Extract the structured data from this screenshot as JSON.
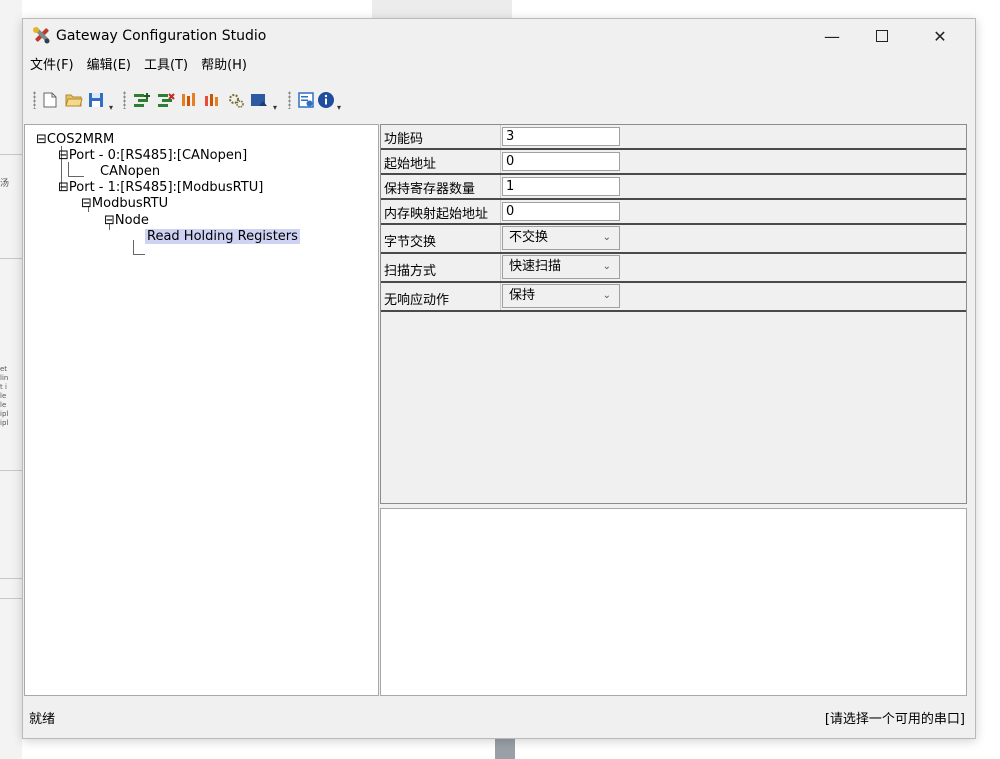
{
  "window": {
    "title": "Gateway Configuration Studio",
    "minimize_glyph": "—",
    "close_glyph": "✕"
  },
  "menu": [
    "文件(F)",
    "编辑(E)",
    "工具(T)",
    "帮助(H)"
  ],
  "toolbar": {
    "icons": [
      "new-file-icon",
      "open-folder-icon",
      "save-icon",
      "add-port-icon",
      "delete-port-icon",
      "add-node-icon",
      "add-command-icon",
      "settings-icon",
      "download-icon",
      "check-icon",
      "info-icon"
    ],
    "more_glyph": "▾"
  },
  "tree": {
    "root": "COS2MRM",
    "port0": "Port - 0:[RS485]:[CANopen]",
    "canopen": "CANopen",
    "port1": "Port - 1:[RS485]:[ModbusRTU]",
    "modbusrtu": "ModbusRTU",
    "node": "Node",
    "command": "Read Holding Registers"
  },
  "properties": [
    {
      "label": "功能码",
      "value": "3",
      "type": "text"
    },
    {
      "label": "起始地址",
      "value": "0",
      "type": "text"
    },
    {
      "label": "保持寄存器数量",
      "value": "1",
      "type": "text"
    },
    {
      "label": "内存映射起始地址",
      "value": "0",
      "type": "text"
    },
    {
      "label": "字节交换",
      "value": "不交换",
      "type": "select"
    },
    {
      "label": "扫描方式",
      "value": "快速扫描",
      "type": "select"
    },
    {
      "label": "无响应动作",
      "value": "保持",
      "type": "select"
    }
  ],
  "status": {
    "left": "就绪",
    "right": "[请选择一个可用的串口]"
  },
  "colors": {
    "selection": "#cfd3f3",
    "window_bg": "#f0f0f0"
  }
}
